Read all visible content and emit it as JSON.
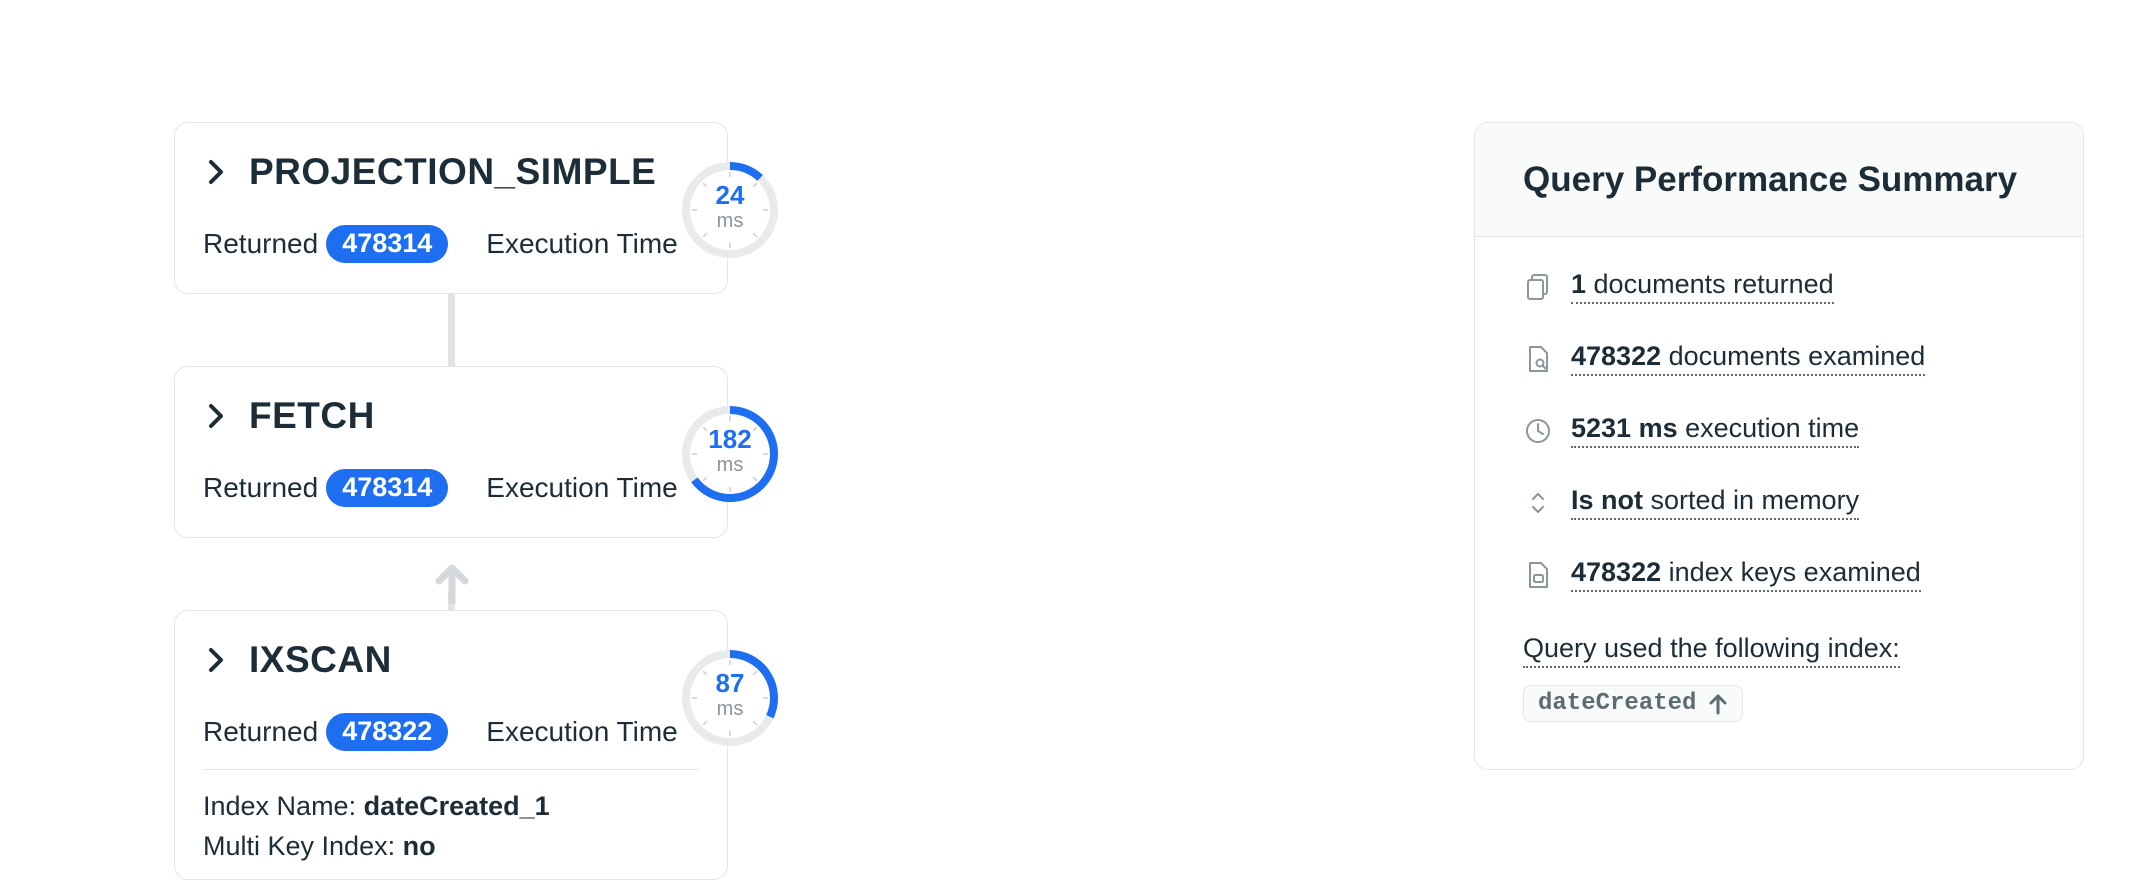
{
  "stages": [
    {
      "id": "projection",
      "name": "PROJECTION_SIMPLE",
      "returned_label": "Returned",
      "returned": "478314",
      "exec_label": "Execution Time",
      "exec_ms": "24",
      "unit": "ms",
      "gauge_fraction": 0.12
    },
    {
      "id": "fetch",
      "name": "FETCH",
      "returned_label": "Returned",
      "returned": "478314",
      "exec_label": "Execution Time",
      "exec_ms": "182",
      "unit": "ms",
      "gauge_fraction": 0.65
    },
    {
      "id": "ixscan",
      "name": "IXSCAN",
      "returned_label": "Returned",
      "returned": "478322",
      "exec_label": "Execution Time",
      "exec_ms": "87",
      "unit": "ms",
      "gauge_fraction": 0.32,
      "details": {
        "index_name_label": "Index Name:",
        "index_name": "dateCreated_1",
        "multi_key_label": "Multi Key Index:",
        "multi_key": "no"
      }
    }
  ],
  "summary": {
    "title": "Query Performance Summary",
    "rows": [
      {
        "icon": "documents-icon",
        "value": "1",
        "text": " documents returned"
      },
      {
        "icon": "document-search-icon",
        "value": "478322",
        "text": " documents examined"
      },
      {
        "icon": "clock-icon",
        "value": "5231 ms",
        "text": " execution time"
      },
      {
        "icon": "sort-icon",
        "value": "Is not",
        "text": " sorted in memory"
      },
      {
        "icon": "index-file-icon",
        "value": "478322",
        "text": " index keys examined"
      }
    ],
    "index_label": "Query used the following index:",
    "index_name": "dateCreated",
    "index_direction_icon": "arrow-up-icon"
  },
  "colors": {
    "accent": "#1e6ef2",
    "gauge_track": "#e8eaeb",
    "text": "#1c2d38"
  }
}
